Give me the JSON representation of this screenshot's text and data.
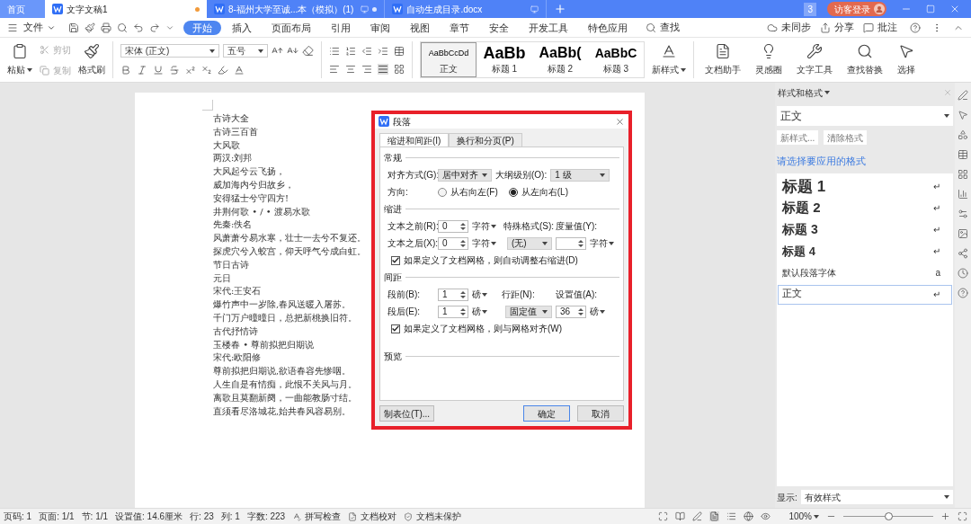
{
  "tabs": [
    {
      "label": "首页",
      "kind": "home",
      "selected": false,
      "modified": false
    },
    {
      "label": "文字文稿1",
      "kind": "doc",
      "selected": true,
      "modified": true
    },
    {
      "label": "8-福州大学至诚...本（模拟）(1)",
      "kind": "doc",
      "selected": false,
      "modified": true
    },
    {
      "label": "自动生成目录.docx",
      "kind": "doc",
      "selected": false,
      "modified": false
    }
  ],
  "window_count": "3",
  "login": "访客登录",
  "menu": {
    "file": "文件",
    "items": [
      {
        "label": "开始",
        "selected": true
      },
      {
        "label": "插入",
        "selected": false
      },
      {
        "label": "页面布局",
        "selected": false
      },
      {
        "label": "引用",
        "selected": false
      },
      {
        "label": "审阅",
        "selected": false
      },
      {
        "label": "视图",
        "selected": false
      },
      {
        "label": "章节",
        "selected": false
      },
      {
        "label": "安全",
        "selected": false
      },
      {
        "label": "开发工具",
        "selected": false
      },
      {
        "label": "特色应用",
        "selected": false
      }
    ],
    "search": "查找",
    "sync": "未同步",
    "share": "分享",
    "comment": "批注"
  },
  "ribbon": {
    "paste": "粘贴",
    "cut": {
      "label": "剪切",
      "disabled": true
    },
    "copy": {
      "label": "复制",
      "disabled": true
    },
    "format_painter": "格式刷",
    "font": "宋体 (正文)",
    "size": "五号",
    "styles": [
      {
        "preview": "AaBbCcDd",
        "label": "正文",
        "selected": true,
        "kind": "body"
      },
      {
        "preview": "AaBb",
        "label": "标题 1",
        "selected": false,
        "kind": "h1"
      },
      {
        "preview": "AaBb(",
        "label": "标题 2",
        "selected": false,
        "kind": "h2"
      },
      {
        "preview": "AaBbC",
        "label": "标题 3",
        "selected": false,
        "kind": "h3"
      }
    ],
    "new_style": "新样式",
    "tools": [
      {
        "label": "文档助手",
        "kind": "assistant"
      },
      {
        "label": "灵感圈",
        "kind": "idea"
      },
      {
        "label": "文字工具",
        "kind": "tools"
      },
      {
        "label": "查找替换",
        "kind": "find"
      },
      {
        "label": "选择",
        "kind": "select"
      }
    ]
  },
  "document": {
    "lines": [
      "古诗大全",
      "古诗三百首",
      "大风歌",
      "两汉:刘邦",
      "大风起兮云飞扬，",
      "威加海内兮归故乡，",
      "安得猛士兮守四方!",
      "井荆何歌 • / • 渡易水歌",
      "先秦:佚名",
      "风萧萧兮易水寒，壮士一去兮不复还。",
      "探虎穴兮入蛟宫，仰天呼气兮成白虹。",
      "节日古诗",
      "元日",
      "宋代:王安石",
      "爆竹声中一岁除,春风送暖入屠苏。",
      "千门万户曈曈日，总把新桃换旧符。",
      "古代抒情诗",
      "玉楼春 • 尊前拟把归期说",
      "宋代:欧阳修",
      "尊前拟把归期说,欲语春容先惨咽。",
      "人生自是有情痴，此恨不关风与月。",
      "离歌且莫翻新阕，一曲能教肠寸结。",
      "直须看尽洛城花,始共春风容易别。"
    ]
  },
  "dialog": {
    "title": "段落",
    "tabs": [
      {
        "label": "缩进和间距(I)",
        "selected": true
      },
      {
        "label": "换行和分页(P)",
        "selected": false
      }
    ],
    "general": {
      "heading": "常规",
      "alignment": {
        "label": "对齐方式(G):",
        "value": "居中对齐"
      },
      "outline": {
        "label": "大纲级别(O):",
        "value": "1 级"
      },
      "direction": {
        "label": "方向:",
        "options": [
          {
            "label": "从右向左(F)",
            "selected": false
          },
          {
            "label": "从左向右(L)",
            "selected": true
          }
        ]
      }
    },
    "indent": {
      "heading": "缩进",
      "before": {
        "label": "文本之前(R):",
        "value": "0",
        "unit": "字符"
      },
      "after": {
        "label": "文本之后(X):",
        "value": "0",
        "unit": "字符"
      },
      "special": {
        "label": "特殊格式(S):",
        "value": "(无)"
      },
      "measure": {
        "label": "度量值(Y):",
        "unit": "字符"
      },
      "grid_check": {
        "label": "如果定义了文档网格，则自动调整右缩进(D)",
        "checked": true
      }
    },
    "spacing": {
      "heading": "间距",
      "before": {
        "label": "段前(B):",
        "value": "1",
        "unit": "磅"
      },
      "after": {
        "label": "段后(E):",
        "value": "1",
        "unit": "磅"
      },
      "line": {
        "label": "行距(N):",
        "value": "固定值"
      },
      "amount": {
        "label": "设置值(A):",
        "value": "36",
        "unit": "磅"
      },
      "grid_check": {
        "label": "如果定义了文档网格，则与网格对齐(W)",
        "checked": true
      }
    },
    "preview": "预览",
    "tab_stops": "制表位(T)...",
    "ok": "确定",
    "cancel": "取消"
  },
  "panel": {
    "title": "样式和格式",
    "current": "正文",
    "new_style": "新样式...",
    "clear": "清除格式",
    "prompt": "请选择要应用的格式",
    "styles": [
      {
        "label": "标题",
        "number": "1",
        "kind": "h1",
        "mark": "↵",
        "selected": false
      },
      {
        "label": "标题",
        "number": "2",
        "kind": "h2",
        "mark": "↵",
        "selected": false
      },
      {
        "label": "标题",
        "number": "3",
        "kind": "h3",
        "mark": "↵",
        "selected": false
      },
      {
        "label": "标题",
        "number": "4",
        "kind": "h4",
        "mark": "↵",
        "selected": false
      },
      {
        "label": "默认段落字体",
        "kind": "char",
        "mark": "a",
        "selected": false
      },
      {
        "label": "正文",
        "kind": "body",
        "mark": "↵",
        "selected": true
      }
    ],
    "show_label": "显示:",
    "show_value": "有效样式"
  },
  "status_bar": {
    "items": [
      "页码: 1",
      "页面: 1/1",
      "节: 1/1",
      "设置值: 14.6厘米",
      "行: 23",
      "列: 1",
      "字数: 223"
    ],
    "spell": "拼写检查",
    "proof": "文档校对",
    "protect": "文档未保护",
    "zoom": "100%",
    "zoom_level": {
      "level": 0.5
    }
  }
}
